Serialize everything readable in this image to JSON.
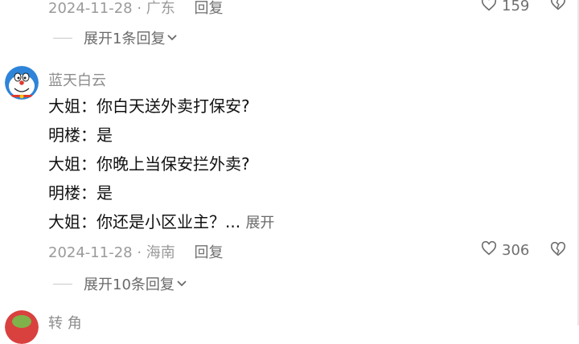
{
  "top_comment": {
    "date": "2024-11-28",
    "location": "广东",
    "reply_label": "回复",
    "like_count": "159",
    "expand_label": "展开1条回复"
  },
  "comment": {
    "username": "蓝天白云",
    "lines": [
      "大姐：你白天送外卖打保安?",
      "明楼：是",
      "大姐：你晚上当保安拦外卖?",
      "明楼：是",
      "大姐：你还是小区业主？..."
    ],
    "more_label": "展开",
    "date": "2024-11-28",
    "location": "海南",
    "reply_label": "回复",
    "like_count": "306",
    "expand_label": "展开10条回复"
  },
  "next_comment": {
    "username": "转 角"
  },
  "colors": {
    "background": "#ffffff",
    "text": "#161616",
    "muted": "#9a9a9a",
    "avatar_blue": "#2e84d8",
    "avatar_red": "#d9413f"
  },
  "icons": {
    "like": "heart-icon",
    "dislike": "broken-heart-icon",
    "expand": "chevron-down-icon"
  }
}
